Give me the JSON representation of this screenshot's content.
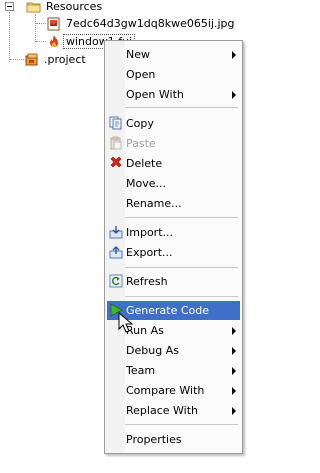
{
  "tree": {
    "folder_label": "Resources",
    "file1_label": "7edc64d3gw1dq8kwe065ij.jpg",
    "file2_label": "window1.fui",
    "project_label": ".project"
  },
  "menu": {
    "items": [
      {
        "label": "New"
      },
      {
        "label": "Open"
      },
      {
        "label": "Open With"
      },
      {
        "label": "Copy"
      },
      {
        "label": "Paste"
      },
      {
        "label": "Delete"
      },
      {
        "label": "Move..."
      },
      {
        "label": "Rename..."
      },
      {
        "label": "Import..."
      },
      {
        "label": "Export..."
      },
      {
        "label": "Refresh"
      },
      {
        "label": "Generate Code"
      },
      {
        "label": "Run As"
      },
      {
        "label": "Debug As"
      },
      {
        "label": "Team"
      },
      {
        "label": "Compare With"
      },
      {
        "label": "Replace With"
      },
      {
        "label": "Properties"
      }
    ]
  },
  "colors": {
    "highlight": "#3f6fc9",
    "menu_bg": "#fbfbfb"
  }
}
